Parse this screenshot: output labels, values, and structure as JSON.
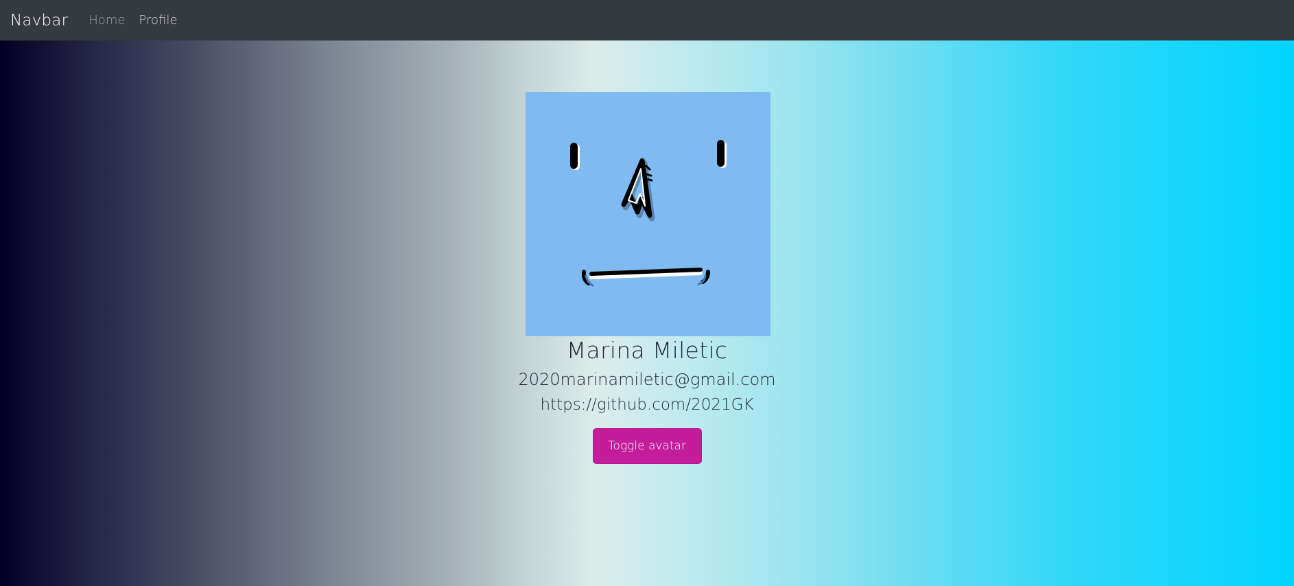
{
  "navbar": {
    "brand": "Navbar",
    "links": [
      {
        "label": "Home"
      },
      {
        "label": "Profile"
      }
    ]
  },
  "profile": {
    "avatar_icon": "cartoon-face-avatar",
    "avatar_bg": "#7fbbf0",
    "name": "Marina Miletic",
    "email": "2020marinamiletic@gmail.com",
    "github": "https://github.com/2021GK",
    "toggle_label": "Toggle avatar"
  },
  "colors": {
    "navbar_bg": "#343a40",
    "button_bg": "#c41d9c",
    "gradient_start": "#020024",
    "gradient_end": "#00d4ff"
  }
}
